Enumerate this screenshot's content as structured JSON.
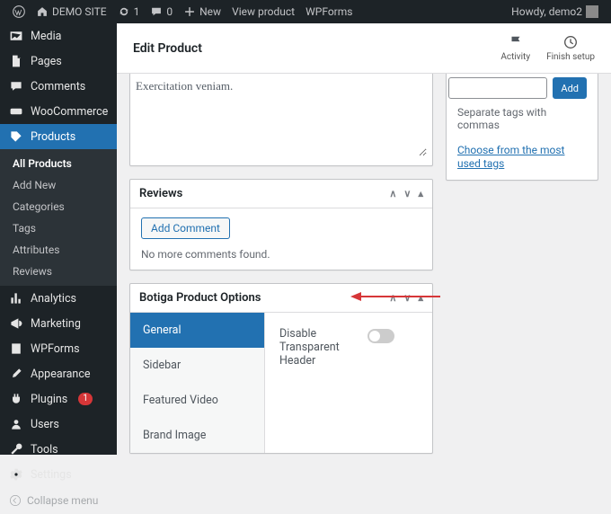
{
  "adminbar": {
    "site_name": "DEMO SITE",
    "updates_count": "1",
    "comments_count": "0",
    "new_label": "New",
    "view_product_label": "View product",
    "wpforms_label": "WPForms",
    "howdy": "Howdy, demo2"
  },
  "sidebar": {
    "media": "Media",
    "pages": "Pages",
    "comments": "Comments",
    "woocommerce": "WooCommerce",
    "products": "Products",
    "products_sub": {
      "all": "All Products",
      "add_new": "Add New",
      "categories": "Categories",
      "tags": "Tags",
      "attributes": "Attributes",
      "reviews": "Reviews"
    },
    "analytics": "Analytics",
    "marketing": "Marketing",
    "wpforms": "WPForms",
    "appearance": "Appearance",
    "plugins": "Plugins",
    "plugins_badge": "1",
    "users": "Users",
    "tools": "Tools",
    "settings": "Settings",
    "collapse": "Collapse menu"
  },
  "header": {
    "title": "Edit Product",
    "activity": "Activity",
    "finish_setup": "Finish setup"
  },
  "editor": {
    "description_value": "Exercitation veniam."
  },
  "reviews": {
    "title": "Reviews",
    "add_comment": "Add Comment",
    "empty": "No more comments found."
  },
  "botiga": {
    "title": "Botiga Product Options",
    "tabs": {
      "general": "General",
      "sidebar": "Sidebar",
      "featured_video": "Featured Video",
      "brand_image": "Brand Image"
    },
    "option_label": "Disable Transparent Header"
  },
  "tags": {
    "add_button": "Add",
    "hint": "Separate tags with commas",
    "choose_link": "Choose from the most used tags"
  }
}
